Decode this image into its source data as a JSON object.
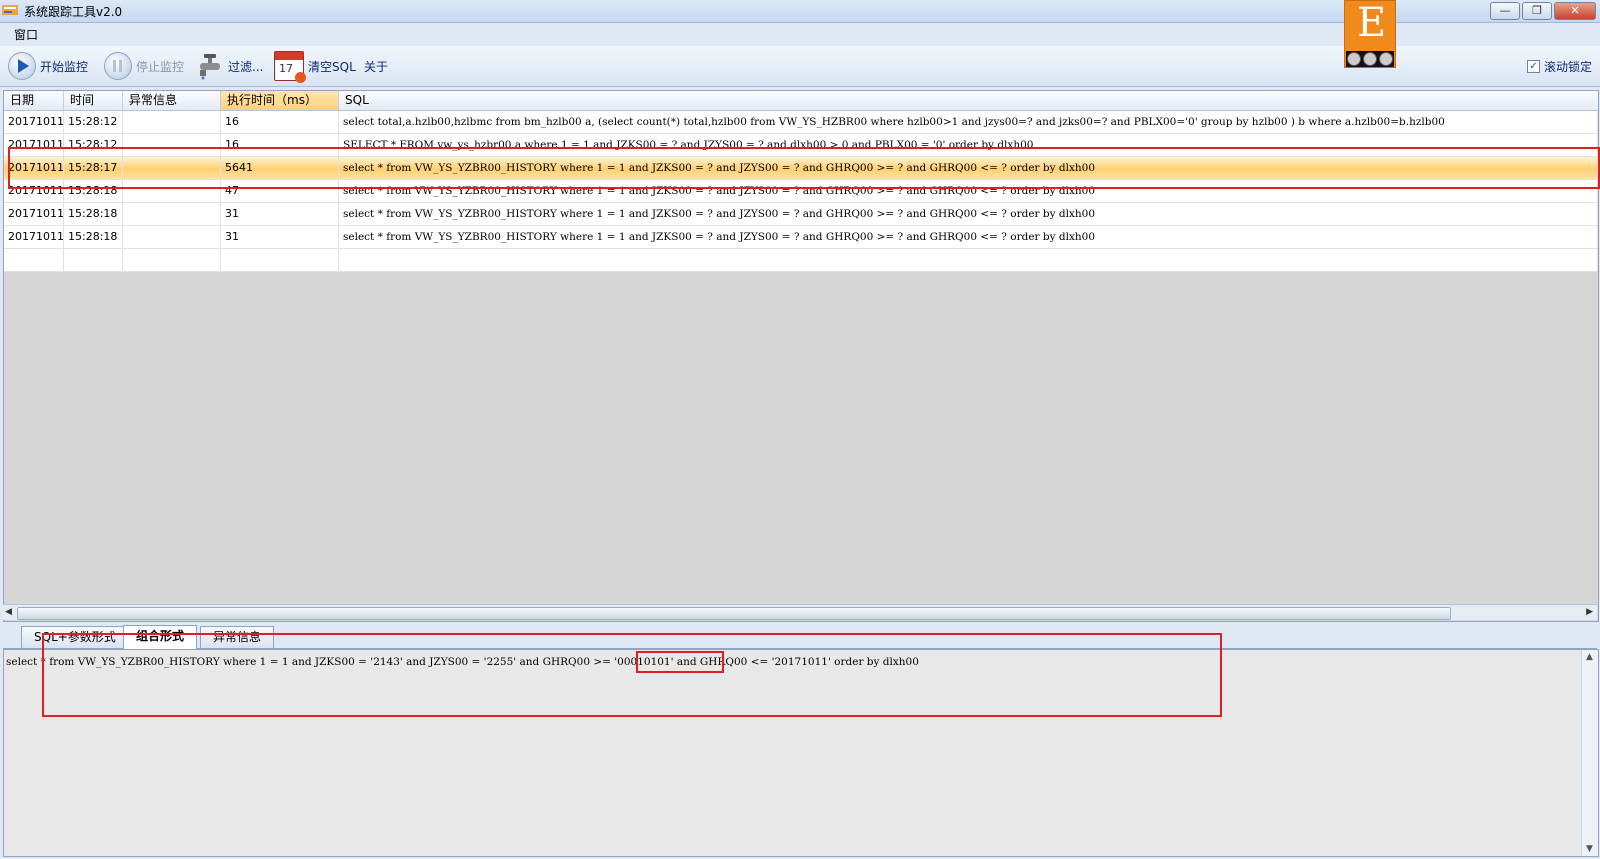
{
  "window": {
    "title": "系统跟踪工具v2.0",
    "buttons": {
      "minimize": "—",
      "restore": "❐",
      "close": "✕"
    }
  },
  "menu": {
    "items": [
      "窗口"
    ]
  },
  "toolbar": {
    "start_label": "开始监控",
    "stop_label": "停止监控",
    "filter_label": "过滤...",
    "clear_label": "清空SQL",
    "about_label": "关于",
    "scroll_lock_label": "滚动锁定",
    "scroll_lock_checked": "✓",
    "calendar_number": "17"
  },
  "logo": {
    "letter": "E"
  },
  "grid": {
    "columns": [
      "日期",
      "时间",
      "异常信息",
      "执行时间（ms）",
      "SQL"
    ],
    "rows": [
      {
        "date": "20171011",
        "time": "15:28:12",
        "error": "",
        "ms": "16",
        "sql": "select total,a.hzlb00,hzlbmc from bm_hzlb00 a,  (select count(*) total,hzlb00 from VW_YS_HZBR00  where hzlb00>1 and jzys00=? and jzks00=?    and PBLX00='0'  group by hzlb00 ) b where  a.hzlb00=b.hzlb00"
      },
      {
        "date": "20171011",
        "time": "15:28:12",
        "error": "",
        "ms": "16",
        "sql": "SELECT * FROM vw_ys_hzbr00 a where 1 = 1  and  JZKS00 = ?  and  JZYS00 = ?    and dlxh00 > 0   and PBLX00 = '0' order by dlxh00"
      },
      {
        "date": "20171011",
        "time": "15:28:17",
        "error": "",
        "ms": "5641",
        "sql": "select * from VW_YS_YZBR00_HISTORY where 1 = 1   and  JZKS00 = ?  and  JZYS00 = ?  and  GHRQ00 >= ?  and  GHRQ00 <= ?  order by dlxh00"
      },
      {
        "date": "20171011",
        "time": "15:28:18",
        "error": "",
        "ms": "47",
        "sql": "select * from VW_YS_YZBR00_HISTORY where 1 = 1   and  JZKS00 = ?  and  JZYS00 = ?  and  GHRQ00 >= ?  and  GHRQ00 <= ?  order by dlxh00"
      },
      {
        "date": "20171011",
        "time": "15:28:18",
        "error": "",
        "ms": "31",
        "sql": "select * from VW_YS_YZBR00_HISTORY where 1 = 1   and  JZKS00 = ?  and  JZYS00 = ?  and  GHRQ00 >= ?  and  GHRQ00 <= ?  order by dlxh00"
      },
      {
        "date": "20171011",
        "time": "15:28:18",
        "error": "",
        "ms": "31",
        "sql": "select * from VW_YS_YZBR00_HISTORY where 1 = 1   and  JZKS00 = ?  and  JZYS00 = ?  and  GHRQ00 >= ?  and  GHRQ00 <= ?  order by dlxh00"
      }
    ],
    "selected_row": 2
  },
  "scrollbar": {
    "left": "◀",
    "right": "▶",
    "up": "▲",
    "down": "▼"
  },
  "tabs": [
    "SQL+参数形式",
    "组合形式",
    "异常信息"
  ],
  "active_tab": 1,
  "detail": {
    "sql": "select * from VW_YS_YZBR00_HISTORY where 1 = 1   and  JZKS00 = '2143'   and  JZYS00 = '2255'   and  GHRQ00 >= '00010101'   and  GHRQ00 <= '20171011'   order by dlxh00"
  },
  "highlight_color": "#e02020"
}
